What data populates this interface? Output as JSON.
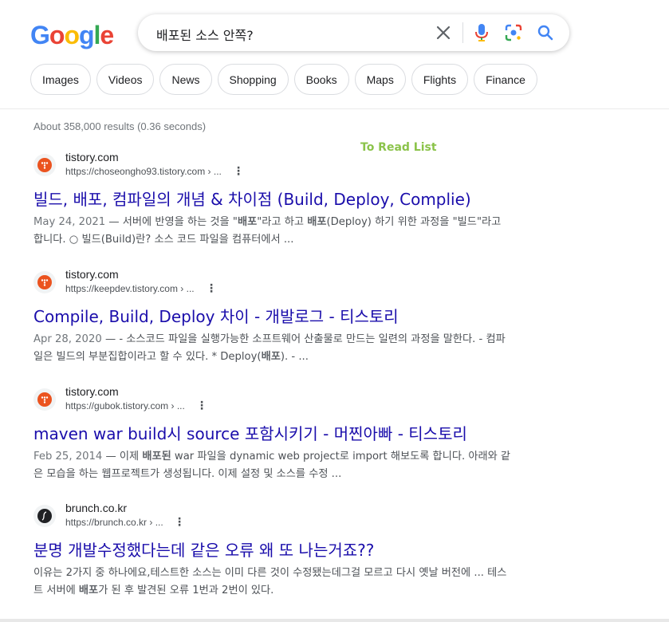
{
  "logo": {
    "letters": [
      "G",
      "o",
      "o",
      "g",
      "l",
      "e"
    ],
    "colors": [
      "#4285f4",
      "#ea4335",
      "#fbbc05",
      "#4285f4",
      "#34a853",
      "#ea4335"
    ]
  },
  "search": {
    "query": "배포된 소스 안쪽?"
  },
  "icons": {
    "clear": "close-icon",
    "voice": "mic-icon",
    "lens": "lens-icon",
    "search": "search-icon"
  },
  "chips": [
    "Images",
    "Videos",
    "News",
    "Shopping",
    "Books",
    "Maps",
    "Flights",
    "Finance"
  ],
  "stats": "About 358,000 results (0.36 seconds)",
  "watermark": "To Read List",
  "results": [
    {
      "site": "tistory.com",
      "url": "https://choseongho93.tistory.com › ...",
      "title": "빌드, 배포, 컴파일의 개념 & 차이점 (Build, Deploy, Complie)",
      "date": "May 24, 2021",
      "snippet_html": "— 서버에 반영을 하는 것을 \"<b>배포</b>\"라고 하고 <b>배포</b>(Deploy) 하기 위한 과정을 \"빌드\"라고 합니다. ○ 빌드(Build)란? 소스 코드 파일을 컴퓨터에서 ..."
    },
    {
      "site": "tistory.com",
      "url": "https://keepdev.tistory.com › ...",
      "title": "Compile, Build, Deploy 차이 - 개발로그 - 티스토리",
      "date": "Apr 28, 2020",
      "snippet_html": "— - 소스코드 파일을 실행가능한 소프트웨어 산출물로 만드는 일련의 과정을 말한다. - 컴파일은 빌드의 부분집합이라고 할 수 있다. * Deploy(<b>배포</b>). - ..."
    },
    {
      "site": "tistory.com",
      "url": "https://gubok.tistory.com › ...",
      "title": "maven war build시 source 포함시키기 - 머찐아빠 - 티스토리",
      "date": "Feb 25, 2014",
      "snippet_html": "— 이제 <b>배포된</b> war 파일을 dynamic web project로 import 해보도록 합니다. 아래와 같은 모습을 하는 웹프로젝트가 생성됩니다. 이제 설정 및 소스를 수정 ..."
    },
    {
      "site": "brunch.co.kr",
      "url": "https://brunch.co.kr › ...",
      "title": "분명 개발수정했다는데 같은 오류 왜 또 나는거죠??",
      "date": "",
      "snippet_html": "이유는 2가지 중 하나에요,테스트한 소스는 이미 다른 것이 수정됐는데그걸 모르고 다시 옛날 버전에 ... 테스트 서버에 <b>배포</b>가 된 후 발견된 오류 1번과 2번이 있다."
    }
  ]
}
